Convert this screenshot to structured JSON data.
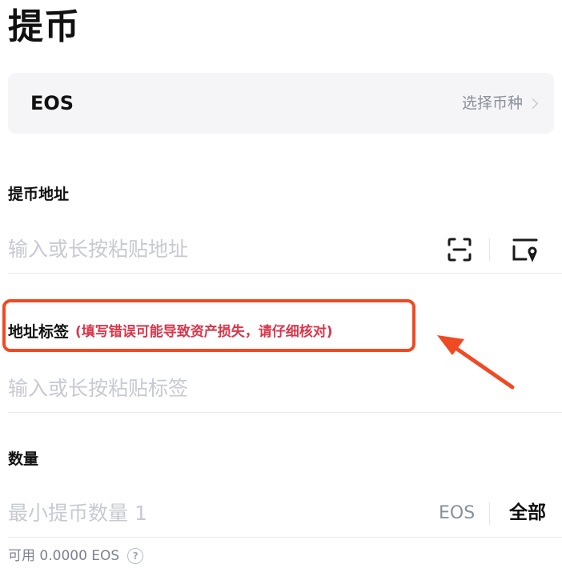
{
  "page": {
    "title": "提币"
  },
  "coin": {
    "name": "EOS",
    "select_label": "选择币种"
  },
  "address": {
    "label": "提币地址",
    "placeholder": "输入或长按粘贴地址"
  },
  "tag": {
    "label": "地址标签",
    "warning": "(填写错误可能导致资产损失，请仔细核对)",
    "placeholder": "输入或长按粘贴标签"
  },
  "amount": {
    "label": "数量",
    "placeholder": "最小提币数量 1",
    "unit": "EOS",
    "all_label": "全部"
  },
  "available": {
    "text": "可用 0.0000 EOS"
  },
  "colors": {
    "highlight": "#f04a24",
    "warning_text": "#d9364a"
  },
  "icons": [
    "scan-icon",
    "address-book-icon",
    "chevron-right-icon",
    "help-icon",
    "annotation-arrow"
  ]
}
